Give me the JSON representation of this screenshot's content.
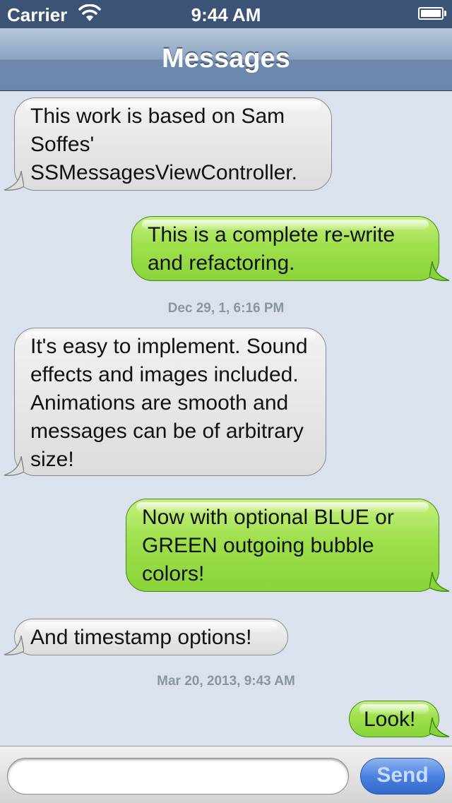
{
  "status_bar": {
    "carrier": "Carrier",
    "time": "9:44 AM"
  },
  "nav": {
    "title": "Messages"
  },
  "messages": [
    {
      "direction": "incoming",
      "text": "This work is based on Sam Soffes' SSMessagesViewController."
    },
    {
      "direction": "outgoing",
      "text": "This is a complete re-write and refactoring."
    },
    {
      "direction": "incoming",
      "text": "It's easy to implement. Sound effects and images included. Animations are smooth and messages can be of arbitrary size!"
    },
    {
      "direction": "outgoing",
      "text": "Now with optional BLUE or GREEN outgoing bubble colors!"
    },
    {
      "direction": "incoming",
      "text": "And timestamp options!"
    },
    {
      "direction": "outgoing",
      "text": "Look!"
    }
  ],
  "timestamps": [
    "Dec 29, 1, 6:16 PM",
    "Mar 20, 2013, 9:43 AM"
  ],
  "input": {
    "value": "",
    "placeholder": ""
  },
  "send_label": "Send",
  "colors": {
    "incoming_bubble": "#e6e6e6",
    "outgoing_bubble": "#9ee04c",
    "send_button": "#4b82e0",
    "nav_bar": "#8ba3c0"
  }
}
